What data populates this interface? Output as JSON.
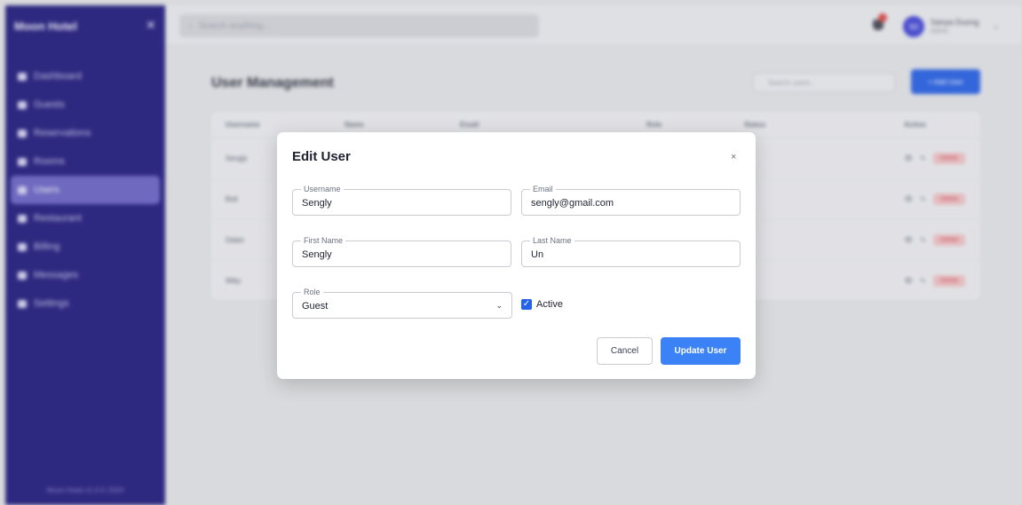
{
  "sidebar": {
    "brand": "Moon Hotel",
    "collapse_icon": "close-icon",
    "items": [
      {
        "label": "Dashboard",
        "icon": "home-icon"
      },
      {
        "label": "Guests",
        "icon": "users-icon"
      },
      {
        "label": "Reservations",
        "icon": "calendar-icon"
      },
      {
        "label": "Rooms",
        "icon": "bed-icon"
      },
      {
        "label": "Users",
        "icon": "user-icon",
        "active": true
      },
      {
        "label": "Restaurant",
        "icon": "utensils-icon"
      },
      {
        "label": "Billing",
        "icon": "file-icon"
      },
      {
        "label": "Messages",
        "icon": "chat-icon"
      },
      {
        "label": "Settings",
        "icon": "gear-icon"
      }
    ],
    "footer": "Moon Hotel v1.0 © 2024"
  },
  "topbar": {
    "search_placeholder": "Search anything...",
    "user_name": "Sanya Duong",
    "user_role": "Admin",
    "avatar_initials": "SD"
  },
  "main": {
    "title": "User Management",
    "search_placeholder": "Search users...",
    "add_button": "+ Add User",
    "table": {
      "headers": [
        "Username",
        "Name",
        "Email",
        "Role",
        "Status",
        "Action"
      ],
      "rows": [
        {
          "username": "Sengly"
        },
        {
          "username": "Bolt"
        },
        {
          "username": "Dalan"
        },
        {
          "username": "Wiky"
        }
      ],
      "view_label": "👁",
      "edit_label": "✎",
      "delete_label": "Delete"
    }
  },
  "modal": {
    "title": "Edit User",
    "close_label": "×",
    "fields": {
      "username": {
        "label": "Username",
        "value": "Sengly"
      },
      "email": {
        "label": "Email",
        "value": "sengly@gmail.com"
      },
      "first_name": {
        "label": "First Name",
        "value": "Sengly"
      },
      "last_name": {
        "label": "Last Name",
        "value": "Un"
      },
      "role": {
        "label": "Role",
        "value": "Guest"
      }
    },
    "active_label": "Active",
    "active_checked": true,
    "cancel_label": "Cancel",
    "update_label": "Update User"
  },
  "colors": {
    "sidebar_bg": "#241e80",
    "primary": "#3b82f6",
    "danger": "#d23d46"
  }
}
